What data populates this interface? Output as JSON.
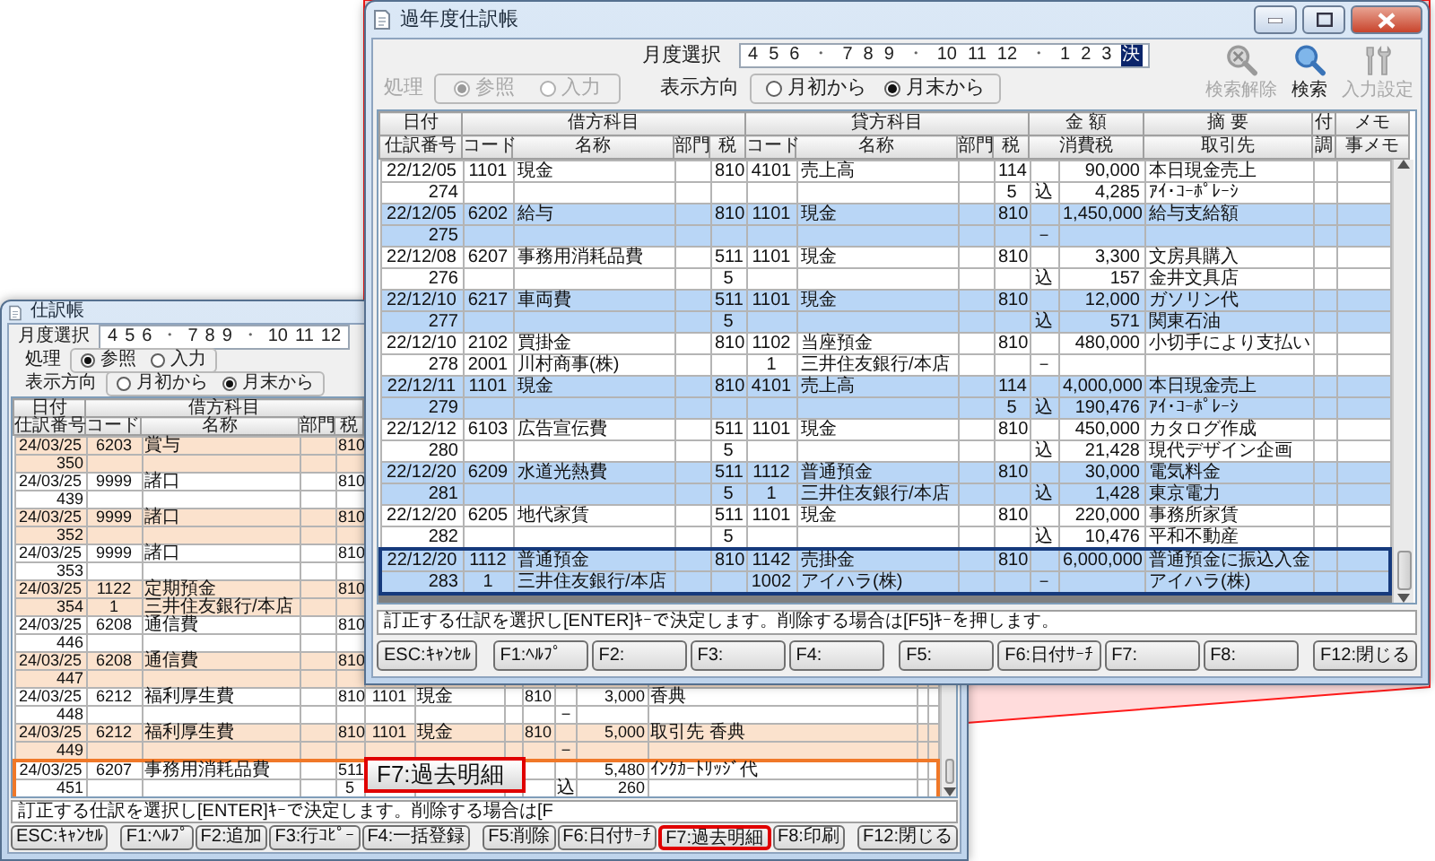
{
  "background_window": {
    "title": "仕訳帳",
    "month_label": "月度選択",
    "months": [
      {
        "label": "4",
        "kind": "month",
        "selected": false
      },
      {
        "label": "5",
        "kind": "month",
        "selected": false
      },
      {
        "label": "6",
        "kind": "month",
        "selected": false
      },
      {
        "label": "・",
        "kind": "separator",
        "selected": false
      },
      {
        "label": "7",
        "kind": "month",
        "selected": false
      },
      {
        "label": "8",
        "kind": "month",
        "selected": false
      },
      {
        "label": "9",
        "kind": "month",
        "selected": false
      },
      {
        "label": "・",
        "kind": "separator",
        "selected": false
      },
      {
        "label": "10",
        "kind": "month",
        "selected": false
      },
      {
        "label": "11",
        "kind": "month",
        "selected": false
      },
      {
        "label": "12",
        "kind": "month",
        "selected": false
      }
    ],
    "mode": {
      "label": "処理",
      "disabled": false,
      "options": [
        {
          "label": "参照",
          "selected": true
        },
        {
          "label": "入力",
          "selected": false
        }
      ]
    },
    "direction": {
      "label": "表示方向",
      "options": [
        {
          "label": "月初から",
          "selected": false
        },
        {
          "label": "月末から",
          "selected": true
        }
      ]
    },
    "table": {
      "header_top": [
        "日付",
        "借方科目"
      ],
      "header_bottom": [
        "仕訳番号",
        "コード",
        "名称",
        "部門",
        "税"
      ],
      "entries": [
        {
          "selected": false,
          "line1": {
            "date": "24/03/25",
            "dr_code": "6203",
            "dr_name": "賞与",
            "dr_tax": "810"
          },
          "line2": {
            "number": "350"
          }
        },
        {
          "selected": false,
          "line1": {
            "date": "24/03/25",
            "dr_code": "9999",
            "dr_name": "諸口",
            "dr_tax": "810"
          },
          "line2": {
            "number": "439"
          }
        },
        {
          "selected": false,
          "line1": {
            "date": "24/03/25",
            "dr_code": "9999",
            "dr_name": "諸口",
            "dr_tax": "810"
          },
          "line2": {
            "number": "352"
          }
        },
        {
          "selected": false,
          "line1": {
            "date": "24/03/25",
            "dr_code": "9999",
            "dr_name": "諸口",
            "dr_tax": "810"
          },
          "line2": {
            "number": "353"
          }
        },
        {
          "selected": false,
          "line1": {
            "date": "24/03/25",
            "dr_code": "1122",
            "dr_name": "定期預金",
            "dr_tax": "810"
          },
          "line2": {
            "number": "354",
            "dr_code": "1",
            "dr_name": "三井住友銀行/本店"
          }
        },
        {
          "selected": false,
          "line1": {
            "date": "24/03/25",
            "dr_code": "6208",
            "dr_name": "通信費",
            "dr_tax": "810"
          },
          "line2": {
            "number": "446"
          }
        },
        {
          "selected": false,
          "line1": {
            "date": "24/03/25",
            "dr_code": "6208",
            "dr_name": "通信費",
            "dr_tax": "810"
          },
          "line2": {
            "number": "447"
          }
        },
        {
          "selected": false,
          "line1": {
            "date": "24/03/25",
            "dr_code": "6212",
            "dr_name": "福利厚生費",
            "dr_tax": "810",
            "cr_code": "1101",
            "cr_name": "現金",
            "cr_tax": "810",
            "amount": "3,000",
            "description": "香典"
          },
          "line2": {
            "number": "448",
            "tax_mark": "－"
          }
        },
        {
          "selected": false,
          "line1": {
            "date": "24/03/25",
            "dr_code": "6212",
            "dr_name": "福利厚生費",
            "dr_tax": "810",
            "cr_code": "1101",
            "cr_name": "現金",
            "cr_tax": "810",
            "amount": "5,000",
            "description": "取引先 香典"
          },
          "line2": {
            "number": "449",
            "tax_mark": "－"
          }
        },
        {
          "selected": true,
          "line1": {
            "date": "24/03/25",
            "dr_code": "6207",
            "dr_name": "事務用消耗品費",
            "dr_tax": "511",
            "amount": "5,480",
            "description": "ｲﾝｸｶｰﾄﾘｯｼﾞ代"
          },
          "line2": {
            "number": "451",
            "dr_tax": "5",
            "tax_mark": "込",
            "amount": "260"
          }
        }
      ]
    },
    "message": "訂正する仕訳を選択し[ENTER]ｷｰで決定します。削除する場合は[F",
    "button_groups": [
      [
        {
          "label": "ESC:ｷｬﾝｾﾙ",
          "highlighted": false
        }
      ],
      [
        {
          "label": "F1:ﾍﾙﾌﾟ",
          "highlighted": false
        },
        {
          "label": "F2:追加",
          "highlighted": false
        },
        {
          "label": "F3:行ｺﾋﾟｰ",
          "highlighted": false
        },
        {
          "label": "F4:一括登録",
          "highlighted": false
        }
      ],
      [
        {
          "label": "F5:削除",
          "highlighted": false
        },
        {
          "label": "F6:日付ｻｰﾁ",
          "highlighted": false
        },
        {
          "label": "F7:過去明細",
          "highlighted": true
        },
        {
          "label": "F8:印刷",
          "highlighted": false
        }
      ],
      [
        {
          "label": "F12:閉じる",
          "highlighted": false
        }
      ]
    ]
  },
  "callout": {
    "label": "F7:過去明細"
  },
  "window": {
    "title": "過年度仕訳帳",
    "month_label": "月度選択",
    "months": [
      {
        "label": "4",
        "kind": "month",
        "selected": false
      },
      {
        "label": "5",
        "kind": "month",
        "selected": false
      },
      {
        "label": "6",
        "kind": "month",
        "selected": false
      },
      {
        "label": "・",
        "kind": "separator",
        "selected": false
      },
      {
        "label": "7",
        "kind": "month",
        "selected": false
      },
      {
        "label": "8",
        "kind": "month",
        "selected": false
      },
      {
        "label": "9",
        "kind": "month",
        "selected": false
      },
      {
        "label": "・",
        "kind": "separator",
        "selected": false
      },
      {
        "label": "10",
        "kind": "month",
        "selected": false
      },
      {
        "label": "11",
        "kind": "month",
        "selected": false
      },
      {
        "label": "12",
        "kind": "month",
        "selected": false
      },
      {
        "label": "・",
        "kind": "separator",
        "selected": false
      },
      {
        "label": "1",
        "kind": "month",
        "selected": false
      },
      {
        "label": "2",
        "kind": "month",
        "selected": false
      },
      {
        "label": "3",
        "kind": "month",
        "selected": false
      },
      {
        "label": "決",
        "kind": "month",
        "selected": true
      }
    ],
    "mode": {
      "label": "処理",
      "disabled": true,
      "options": [
        {
          "label": "参照",
          "selected": true
        },
        {
          "label": "入力",
          "selected": false
        }
      ]
    },
    "direction": {
      "label": "表示方向",
      "options": [
        {
          "label": "月初から",
          "selected": false
        },
        {
          "label": "月末から",
          "selected": true
        }
      ]
    },
    "toolbar": [
      {
        "kind": "clear",
        "label": "検索解除",
        "disabled": true
      },
      {
        "kind": "search",
        "label": "検索",
        "disabled": false
      },
      {
        "kind": "settings",
        "label": "入力設定",
        "disabled": true
      }
    ],
    "table": {
      "header_top": [
        "日付",
        "借方科目",
        "貸方科目",
        "金 額",
        "摘 要",
        "付",
        "メモ"
      ],
      "header_bottom": [
        "仕訳番号",
        "コード",
        "名称",
        "部門",
        "税",
        "コード",
        "名称",
        "部門",
        "税",
        "消費税",
        "取引先",
        "調",
        "事メモ"
      ],
      "entries": [
        {
          "selected": false,
          "line1": {
            "date": "22/12/05",
            "dr_code": "1101",
            "dr_name": "現金",
            "dr_tax": "810",
            "cr_code": "4101",
            "cr_name": "売上高",
            "cr_tax": "114",
            "amount": "90,000",
            "description": "本日現金売上"
          },
          "line2": {
            "number": "274",
            "cr_tax": "5",
            "tax_mark": "込",
            "amount": "4,285",
            "vendor": "ｱｲ･ｺｰﾎﾟﾚｰｼ"
          }
        },
        {
          "selected": false,
          "line1": {
            "date": "22/12/05",
            "dr_code": "6202",
            "dr_name": "給与",
            "dr_tax": "810",
            "cr_code": "1101",
            "cr_name": "現金",
            "cr_tax": "810",
            "amount": "1,450,000",
            "description": "給与支給額"
          },
          "line2": {
            "number": "275",
            "tax_mark": "－"
          }
        },
        {
          "selected": false,
          "line1": {
            "date": "22/12/08",
            "dr_code": "6207",
            "dr_name": "事務用消耗品費",
            "dr_tax": "511",
            "cr_code": "1101",
            "cr_name": "現金",
            "cr_tax": "810",
            "amount": "3,300",
            "description": "文房具購入"
          },
          "line2": {
            "number": "276",
            "dr_tax": "5",
            "tax_mark": "込",
            "amount": "157",
            "vendor": "金井文具店"
          }
        },
        {
          "selected": false,
          "line1": {
            "date": "22/12/10",
            "dr_code": "6217",
            "dr_name": "車両費",
            "dr_tax": "511",
            "cr_code": "1101",
            "cr_name": "現金",
            "cr_tax": "810",
            "amount": "12,000",
            "description": "ガソリン代"
          },
          "line2": {
            "number": "277",
            "dr_tax": "5",
            "tax_mark": "込",
            "amount": "571",
            "vendor": "関東石油"
          }
        },
        {
          "selected": false,
          "line1": {
            "date": "22/12/10",
            "dr_code": "2102",
            "dr_name": "買掛金",
            "dr_tax": "810",
            "cr_code": "1102",
            "cr_name": "当座預金",
            "cr_tax": "810",
            "amount": "480,000",
            "description": "小切手により支払い"
          },
          "line2": {
            "number": "278",
            "dr_code": "2001",
            "dr_name": "川村商事(株)",
            "cr_code": "1",
            "cr_name": "三井住友銀行/本店",
            "tax_mark": "－"
          }
        },
        {
          "selected": false,
          "line1": {
            "date": "22/12/11",
            "dr_code": "1101",
            "dr_name": "現金",
            "dr_tax": "810",
            "cr_code": "4101",
            "cr_name": "売上高",
            "cr_tax": "114",
            "amount": "4,000,000",
            "description": "本日現金売上"
          },
          "line2": {
            "number": "279",
            "cr_tax": "5",
            "tax_mark": "込",
            "amount": "190,476",
            "vendor": "ｱｲ･ｺｰﾎﾟﾚｰｼ"
          }
        },
        {
          "selected": false,
          "line1": {
            "date": "22/12/12",
            "dr_code": "6103",
            "dr_name": "広告宣伝費",
            "dr_tax": "511",
            "cr_code": "1101",
            "cr_name": "現金",
            "cr_tax": "810",
            "amount": "450,000",
            "description": "カタログ作成"
          },
          "line2": {
            "number": "280",
            "dr_tax": "5",
            "tax_mark": "込",
            "amount": "21,428",
            "vendor": "現代デザイン企画"
          }
        },
        {
          "selected": false,
          "line1": {
            "date": "22/12/20",
            "dr_code": "6209",
            "dr_name": "水道光熱費",
            "dr_tax": "511",
            "cr_code": "1112",
            "cr_name": "普通預金",
            "cr_tax": "810",
            "amount": "30,000",
            "description": "電気料金"
          },
          "line2": {
            "number": "281",
            "dr_tax": "5",
            "cr_code": "1",
            "cr_name": "三井住友銀行/本店",
            "tax_mark": "込",
            "amount": "1,428",
            "vendor": "東京電力"
          }
        },
        {
          "selected": false,
          "line1": {
            "date": "22/12/20",
            "dr_code": "6205",
            "dr_name": "地代家賃",
            "dr_tax": "511",
            "cr_code": "1101",
            "cr_name": "現金",
            "cr_tax": "810",
            "amount": "220,000",
            "description": "事務所家賃"
          },
          "line2": {
            "number": "282",
            "dr_tax": "5",
            "tax_mark": "込",
            "amount": "10,476",
            "vendor": "平和不動産"
          }
        },
        {
          "selected": true,
          "line1": {
            "date": "22/12/20",
            "dr_code": "1112",
            "dr_name": "普通預金",
            "dr_tax": "810",
            "cr_code": "1142",
            "cr_name": "売掛金",
            "cr_tax": "810",
            "amount": "6,000,000",
            "description": "普通預金に振込入金"
          },
          "line2": {
            "number": "283",
            "dr_code": "1",
            "dr_name": "三井住友銀行/本店",
            "cr_code": "1002",
            "cr_name": "アイハラ(株)",
            "tax_mark": "－",
            "vendor": "アイハラ(株)"
          }
        }
      ]
    },
    "message": "訂正する仕訳を選択し[ENTER]ｷｰで決定します。削除する場合は[F5]ｷｰを押します。",
    "button_groups": [
      [
        {
          "label": "ESC:ｷｬﾝｾﾙ",
          "highlighted": false
        }
      ],
      [
        {
          "label": "F1:ﾍﾙﾌﾟ",
          "highlighted": false
        },
        {
          "label": "F2:",
          "highlighted": false
        },
        {
          "label": "F3:",
          "highlighted": false
        },
        {
          "label": "F4:",
          "highlighted": false
        }
      ],
      [
        {
          "label": "F5:",
          "highlighted": false
        },
        {
          "label": "F6:日付ｻｰﾁ",
          "highlighted": false
        },
        {
          "label": "F7:",
          "highlighted": false
        },
        {
          "label": "F8:",
          "highlighted": false
        }
      ],
      [
        {
          "label": "F12:閉じる",
          "highlighted": false
        }
      ]
    ]
  }
}
